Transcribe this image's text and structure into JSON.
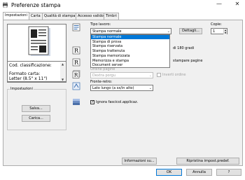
{
  "window": {
    "title": "Preferenze stampa",
    "minimize": "—",
    "close": "✕"
  },
  "tabs": [
    {
      "label": "Impostazioni",
      "active": true
    },
    {
      "label": "Carta"
    },
    {
      "label": "Qualità di stampa"
    },
    {
      "label": "Accesso valido"
    },
    {
      "label": "Timbri"
    }
  ],
  "preview": {
    "info_lines": [
      "Cod. classificazione:",
      "",
      "Formato carta:",
      "Letter (8.5\" x 11\")"
    ],
    "scroll_up": "▲",
    "scroll_down": "▼"
  },
  "settings_group": {
    "title": "Impostazioni",
    "save_label": "Salva...",
    "load_label": "Carica..."
  },
  "job": {
    "type_label": "Tipo lavoro:",
    "type_value": "Stampa normale",
    "details_label": "Dettagli...",
    "copies_label": "Copie:",
    "copies_value": "1",
    "dropdown_options": [
      "Stampa normale",
      "Stampa di prova",
      "Stampa riservata",
      "Stampa trattenuta",
      "Stampa memorizzata",
      "Memorizza e stampa",
      "Document server"
    ],
    "dropdown_selected_index": 0
  },
  "behind_dropdown": {
    "rotate_label": "di 180 gradi",
    "blank_pages_label": "stampare pagine"
  },
  "page_order": {
    "label": "Ordine pagine",
    "value": "Dextra porgu",
    "reverse_label": "Inverti ordine"
  },
  "duplex": {
    "label": "Fronte-retro:",
    "value": "Lato lungo (a sx/in alto)"
  },
  "ignore_tray": {
    "label": "Ignora fascicol.applicaz.",
    "checked": true
  },
  "bottom": {
    "info_label": "Informazioni su...",
    "restore_label": "Ripristina impost.predef.",
    "ok_label": "OK",
    "cancel_label": "Annulla",
    "help_label": "?"
  },
  "colors": {
    "accent": "#0078d7",
    "panel": "#f0f0f0",
    "button": "#e1e1e1"
  }
}
